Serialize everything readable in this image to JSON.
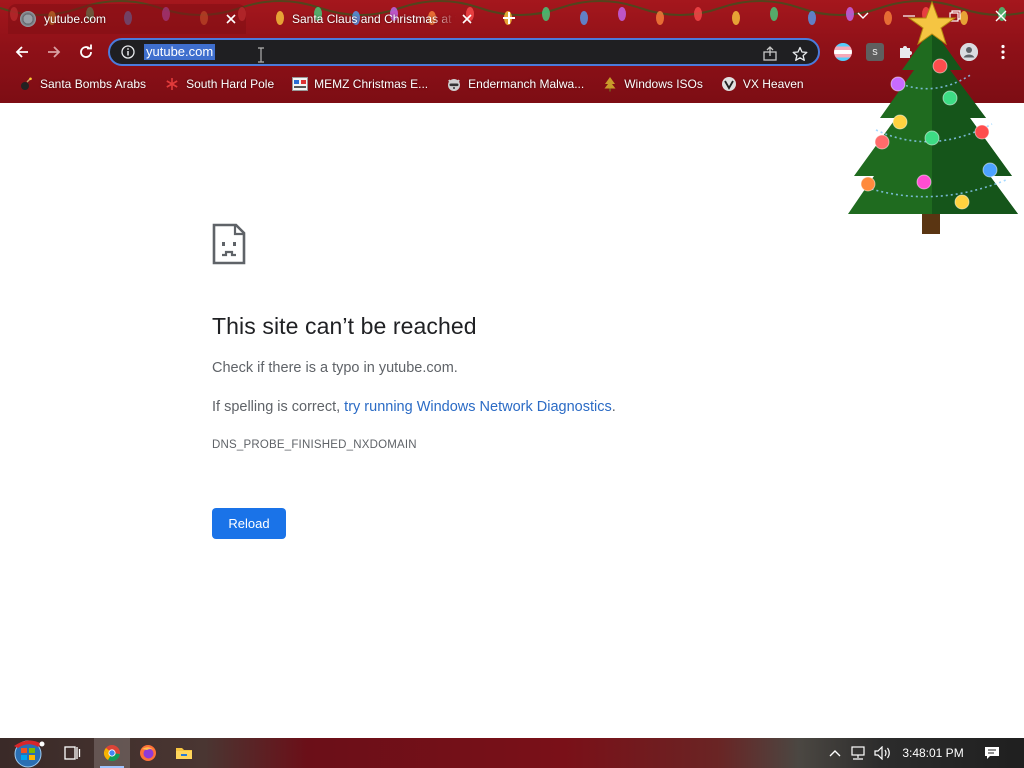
{
  "browser": {
    "tabs": [
      {
        "title": "yutube.com",
        "active": true
      },
      {
        "title": "Santa Claus and Christmas at the",
        "active": false
      }
    ],
    "address_bar": {
      "url": "yutube.com"
    },
    "bookmarks": [
      {
        "label": "Santa Bombs Arabs",
        "icon": "bomb-icon"
      },
      {
        "label": "South Hard Pole",
        "icon": "snowflake-icon"
      },
      {
        "label": "MEMZ Christmas E...",
        "icon": "memz-icon"
      },
      {
        "label": "Endermanch Malwa...",
        "icon": "raccoon-icon"
      },
      {
        "label": "Windows ISOs",
        "icon": "tree-icon"
      },
      {
        "label": "VX Heaven",
        "icon": "vx-icon"
      }
    ],
    "extensions": {
      "s_label": "s"
    },
    "theme_color": "#8f1118"
  },
  "error_page": {
    "title": "This site can’t be reached",
    "check_text": "Check if there is a typo in yutube.com.",
    "spell_prefix": "If spelling is correct, ",
    "spell_link": "try running Windows Network Diagnostics",
    "spell_suffix": ".",
    "error_code": "DNS_PROBE_FINISHED_NXDOMAIN",
    "reload_label": "Reload",
    "accent": "#1a73e8"
  },
  "taskbar": {
    "clock": "3:48:01 PM",
    "pinned": [
      "task-view-icon",
      "chrome-icon",
      "firefox-icon",
      "file-explorer-icon"
    ]
  }
}
